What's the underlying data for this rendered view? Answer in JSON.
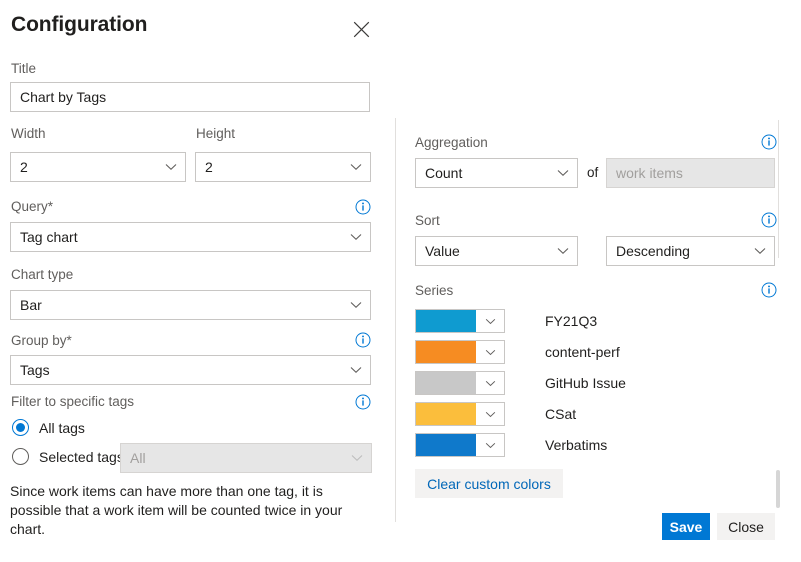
{
  "dialog": {
    "title": "Configuration",
    "close_icon": "close-icon"
  },
  "left": {
    "title_field": {
      "label": "Title",
      "value": "Chart by Tags"
    },
    "width_field": {
      "label": "Width",
      "value": "2"
    },
    "height_field": {
      "label": "Height",
      "value": "2"
    },
    "query_field": {
      "label": "Query*",
      "value": "Tag chart",
      "info_icon": "info-icon"
    },
    "chart_type_field": {
      "label": "Chart type",
      "value": "Bar"
    },
    "group_by_field": {
      "label": "Group by*",
      "value": "Tags",
      "info_icon": "info-icon"
    },
    "filter_section": {
      "label": "Filter to specific tags",
      "info_icon": "info-icon",
      "options": [
        {
          "label": "All tags",
          "selected": true
        },
        {
          "label": "Selected tags",
          "selected": false
        }
      ],
      "tags_dropdown_value": "All",
      "tags_dropdown_disabled": true
    },
    "help_text": "Since work items can have more than one tag, it is possible that a work item will be counted twice in your chart."
  },
  "right": {
    "aggregation": {
      "label": "Aggregation",
      "info_icon": "info-icon",
      "value": "Count",
      "of_label": "of",
      "of_value": "work items",
      "of_disabled": true
    },
    "sort": {
      "label": "Sort",
      "info_icon": "info-icon",
      "field_value": "Value",
      "direction_value": "Descending"
    },
    "series": {
      "label": "Series",
      "info_icon": "info-icon",
      "items": [
        {
          "name": "FY21Q3",
          "color": "#0f9bd0"
        },
        {
          "name": "content-perf",
          "color": "#f68c22"
        },
        {
          "name": "GitHub Issue",
          "color": "#c8c8c8"
        },
        {
          "name": "CSat",
          "color": "#fbbe3c"
        },
        {
          "name": "Verbatims",
          "color": "#0f79cb"
        }
      ]
    },
    "clear_colors_button": "Clear custom colors",
    "save_button": "Save",
    "close_button": "Close"
  }
}
